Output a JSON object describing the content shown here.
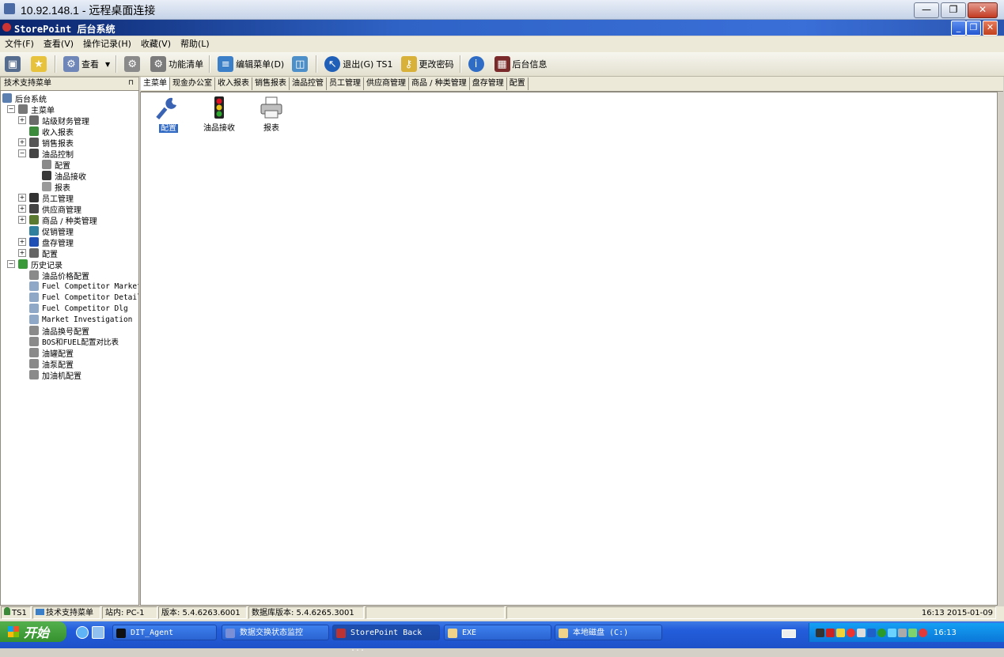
{
  "rdp": {
    "title": "10.92.148.1 - 远程桌面连接"
  },
  "app": {
    "title": "StorePoint 后台系统"
  },
  "menu": [
    "文件(F)",
    "查看(V)",
    "操作记录(H)",
    "收藏(V)",
    "帮助(L)"
  ],
  "toolbar": {
    "view": "查看",
    "function_list": "功能清单",
    "edit_menu": "编辑菜单(D)",
    "exit": "退出(G) TS1",
    "change_password": "更改密码",
    "backend_info": "后台信息"
  },
  "left_panel": {
    "header": "技术支持菜单",
    "tree": [
      {
        "label": "后台系统",
        "indent": 0,
        "expander": "",
        "icon": "network-icon",
        "color": "#5b7fb0"
      },
      {
        "label": "主菜单",
        "indent": 1,
        "expander": "−",
        "icon": "menu-icon",
        "color": "#777777"
      },
      {
        "label": "站级财务管理",
        "indent": 2,
        "expander": "+",
        "icon": "finance-icon",
        "color": "#6b6b6b"
      },
      {
        "label": "收入报表",
        "indent": 2,
        "expander": "",
        "icon": "income-icon",
        "color": "#3c8a3c"
      },
      {
        "label": "销售报表",
        "indent": 2,
        "expander": "+",
        "icon": "sales-icon",
        "color": "#555555"
      },
      {
        "label": "油品控制",
        "indent": 2,
        "expander": "−",
        "icon": "fuel-control-icon",
        "color": "#444444"
      },
      {
        "label": "配置",
        "indent": 3,
        "expander": "",
        "icon": "wrench-icon",
        "color": "#8a8a8a"
      },
      {
        "label": "油品接收",
        "indent": 3,
        "expander": "",
        "icon": "traffic-light-icon",
        "color": "#3a3a3a"
      },
      {
        "label": "报表",
        "indent": 3,
        "expander": "",
        "icon": "printer-icon",
        "color": "#9a9a9a"
      },
      {
        "label": "员工管理",
        "indent": 2,
        "expander": "+",
        "icon": "staff-icon",
        "color": "#333333"
      },
      {
        "label": "供应商管理",
        "indent": 2,
        "expander": "+",
        "icon": "supplier-icon",
        "color": "#444444"
      },
      {
        "label": "商品 / 种类管理",
        "indent": 2,
        "expander": "+",
        "icon": "product-icon",
        "color": "#5a7a30"
      },
      {
        "label": "促销管理",
        "indent": 2,
        "expander": "",
        "icon": "promotion-icon",
        "color": "#2f7f9f"
      },
      {
        "label": "盘存管理",
        "indent": 2,
        "expander": "+",
        "icon": "info-icon",
        "color": "#1f4fb5"
      },
      {
        "label": "配置",
        "indent": 2,
        "expander": "+",
        "icon": "config-icon",
        "color": "#666666"
      },
      {
        "label": "历史记录",
        "indent": 1,
        "expander": "−",
        "icon": "history-icon",
        "color": "#3a9a3a"
      },
      {
        "label": "油品价格配置",
        "indent": 2,
        "expander": "",
        "icon": "wrench-icon",
        "color": "#8a8a8a"
      },
      {
        "label": "Fuel Competitor Market",
        "indent": 2,
        "expander": "",
        "icon": "doc-icon",
        "color": "#8fa8c8"
      },
      {
        "label": "Fuel Competitor Detail",
        "indent": 2,
        "expander": "",
        "icon": "doc-icon",
        "color": "#8fa8c8"
      },
      {
        "label": "Fuel Competitor Dlg",
        "indent": 2,
        "expander": "",
        "icon": "doc-icon",
        "color": "#8fa8c8"
      },
      {
        "label": "Market Investigation",
        "indent": 2,
        "expander": "",
        "icon": "doc-icon",
        "color": "#8fa8c8"
      },
      {
        "label": "油品换号配置",
        "indent": 2,
        "expander": "",
        "icon": "wrench-icon",
        "color": "#8a8a8a"
      },
      {
        "label": "BOS和FUEL配置对比表",
        "indent": 2,
        "expander": "",
        "icon": "wrench-icon",
        "color": "#8a8a8a"
      },
      {
        "label": "油罐配置",
        "indent": 2,
        "expander": "",
        "icon": "wrench-icon",
        "color": "#8a8a8a"
      },
      {
        "label": "油泵配置",
        "indent": 2,
        "expander": "",
        "icon": "wrench-icon",
        "color": "#8a8a8a"
      },
      {
        "label": "加油机配置",
        "indent": 2,
        "expander": "",
        "icon": "wrench-icon",
        "color": "#8a8a8a"
      }
    ]
  },
  "tabs": [
    "主菜单",
    "现金办公室",
    "收入报表",
    "销售报表",
    "油品控管",
    "员工管理",
    "供应商管理",
    "商品 / 种类管理",
    "盘存管理",
    "配置"
  ],
  "main_icons": [
    {
      "label": "配置",
      "icon": "wrench-icon"
    },
    {
      "label": "油品接收",
      "icon": "traffic-light-icon"
    },
    {
      "label": "报表",
      "icon": "printer-icon"
    }
  ],
  "status": {
    "user": "TS1",
    "menu": "技术支持菜单",
    "station": "站内: PC-1",
    "version": "版本: 5.4.6263.6001",
    "db_version": "数据库版本: 5.4.6265.3001",
    "datetime": "16:13 2015-01-09"
  },
  "taskbar": {
    "start": "开始",
    "tasks": [
      "DIT_Agent",
      "数据交换状态监控",
      "StorePoint Back ...",
      "EXE",
      "本地磁盘 (C:)"
    ],
    "clock": "16:13"
  }
}
